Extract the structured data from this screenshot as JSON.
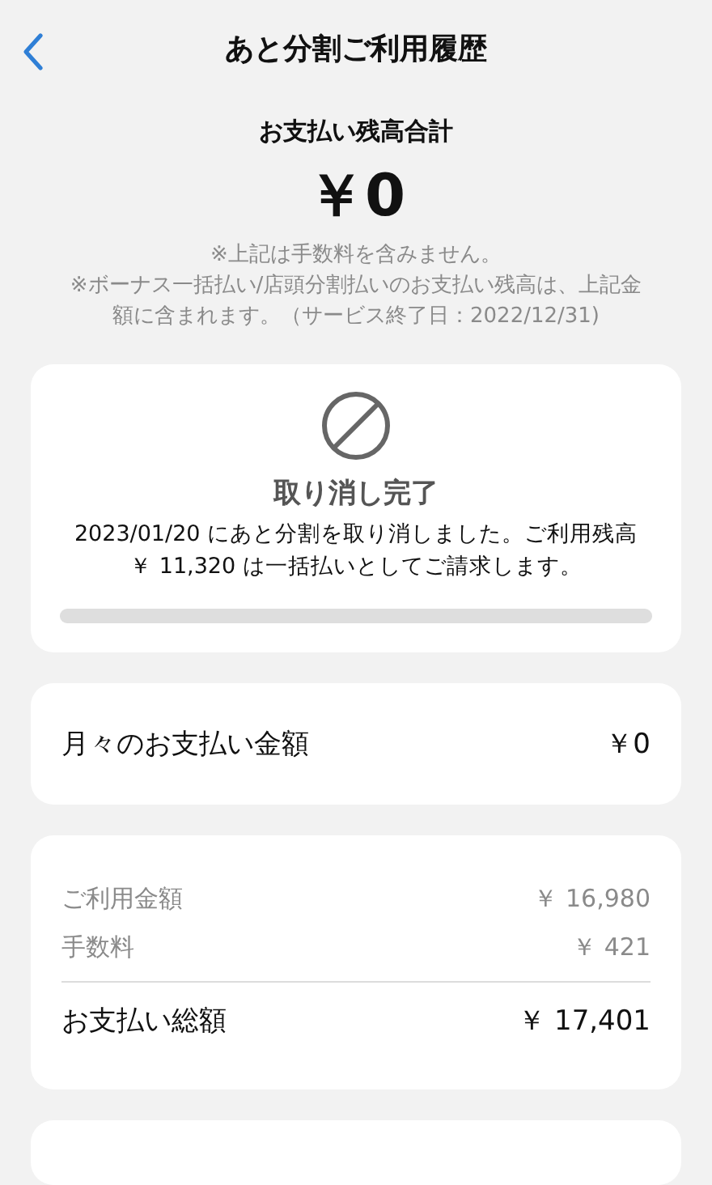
{
  "header": {
    "title": "あと分割ご利用履歴"
  },
  "summary": {
    "label": "お支払い残高合計",
    "amount": "￥0",
    "notes": [
      "※上記は手数料を含みません。",
      "※ボーナス一括払い/店頭分割払いのお支払い残高は、上記金額に含まれます。（サービス終了日：2022/12/31)"
    ]
  },
  "status_card": {
    "title": "取り消し完了",
    "message": "2023/01/20 にあと分割を取り消しました。ご利用残高￥ 11,320 は一括払いとしてご請求します。"
  },
  "monthly": {
    "label": "月々のお支払い金額",
    "amount": "￥0"
  },
  "breakdown": [
    {
      "kind": "detail",
      "label": "ご利用金額",
      "amount": "￥ 16,980"
    },
    {
      "kind": "detail",
      "label": "手数料",
      "amount": "￥ 421"
    },
    {
      "kind": "total",
      "label": "お支払い総額",
      "amount": "￥ 17,401"
    }
  ]
}
